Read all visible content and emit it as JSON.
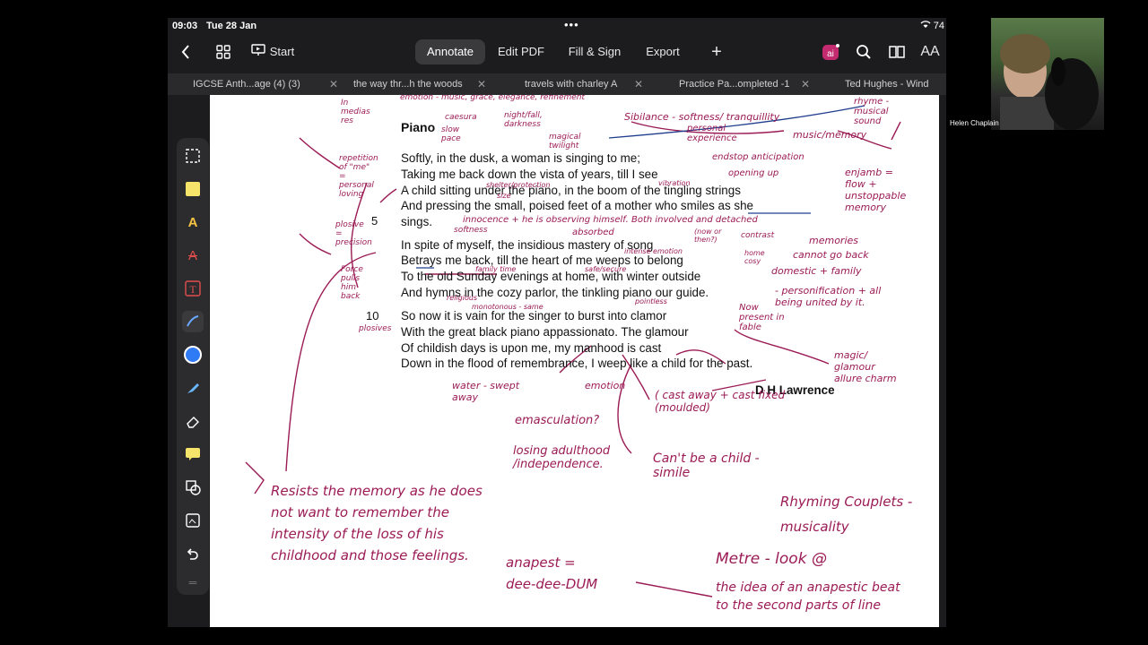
{
  "status": {
    "time": "09:03",
    "date": "Tue 28 Jan",
    "battery": "74"
  },
  "toolbar": {
    "back_icon": "chevron-left-icon",
    "grid_icon": "grid-icon",
    "start_label": "Start",
    "annotate_label": "Annotate",
    "edit_pdf_label": "Edit PDF",
    "fill_sign_label": "Fill & Sign",
    "export_label": "Export",
    "add_label": "+",
    "ai_label": "ai",
    "aa_label": "AA"
  },
  "tabs": [
    {
      "label": "IGCSE Anth...age (4) (3)"
    },
    {
      "label": "the way thr...h the woods"
    },
    {
      "label": "travels with charley A"
    },
    {
      "label": "Practice Pa...ompleted -1"
    },
    {
      "label": "Ted Hughes - Wind"
    }
  ],
  "document": {
    "title": "Piano",
    "lines": [
      "Softly, in the dusk, a woman is singing to me;",
      "Taking me back down the vista of years, till I see",
      "A child sitting under the piano, in the boom of the tingling strings",
      "And pressing the small, poised feet of a mother who smiles as she",
      "sings.",
      "In spite of myself, the insidious mastery of song",
      "Betrays me back, till the heart of me weeps to belong",
      "To the old Sunday evenings at home, with winter outside",
      "And hymns in the cozy parlor, the tinkling piano our guide.",
      "So now it is vain for the singer to burst into clamor",
      "With the great black piano appassionato. The glamour",
      "Of childish days is upon me, my manhood is cast",
      "Down in the flood of remembrance, I weep like a child for the past."
    ],
    "line_number_5": "5",
    "line_number_10": "10",
    "author": "D H Lawrence"
  },
  "annotations": {
    "caesura": "caesura",
    "slow_pace": "slow pace",
    "night_fall": "night/fall, darkness",
    "magical_twilight": "magical twilight",
    "sibilance": "Sibilance - softness/ tranquillity",
    "rhyme": "rhyme - musical sound",
    "personal_experience": "personal experience",
    "music_memory": "music/memory",
    "endstop": "endstop anticipation",
    "opening_up": "opening up",
    "enjamb": "enjamb = flow + unstoppable memory",
    "repetition": "repetition of \"me\" = personal loving",
    "shelter": "shelter/protection",
    "size": "size",
    "vibration": "vibration",
    "innocence": "innocence + he is observing himself. Both involved and detached",
    "absorbed": "absorbed",
    "softness": "softness",
    "now_or_then": "(now or then?)",
    "contrast": "contrast",
    "memories": "memories",
    "cannot_go_back": "cannot go back",
    "domestic_family": "domestic + family",
    "plosive": "plosive = precision",
    "force_pulls": "Force pulls him back",
    "intense_emotion": "intense emotion",
    "family_time": "family time",
    "safe_secure": "safe/secure",
    "home_cosy": "home cosy",
    "personification": "- personification + all being united by it.",
    "religious": "religious",
    "monotonous": "monotonous - same",
    "pointless": "pointless",
    "now_present": "Now present in fable",
    "plosives": "plosives",
    "magic_glamour": "magic/ glamour allure charm",
    "water": "water - swept away",
    "emotion": "emotion",
    "cast_away": "( cast away + cast fixed (moulded)",
    "emasculation": "emasculation?",
    "losing_adulthood": "losing adulthood /independence.",
    "cant_be_child": "Can't be a child - simile",
    "resists": "Resists the memory as he does not want to remember the intensity of the loss of his childhood and those feelings.",
    "anapest": "anapest = dee-dee-DUM",
    "rhyming_couplets": "Rhyming Couplets - musicality",
    "metre": "Metre - look @",
    "idea": "the idea of an anapestic beat to the second parts of line",
    "in_medias_res": "In medias res",
    "emotion_music": "emotion - music, grace, elegance, refinement"
  },
  "video": {
    "name": "Helen Chaplain"
  },
  "colors": {
    "ink": "#9b1b55",
    "toolbar_bg": "#1c1c1e",
    "tabs_bg": "#2a2a2c",
    "accent_blue": "#2f7bf5",
    "highlighter": "#f6e46b"
  }
}
